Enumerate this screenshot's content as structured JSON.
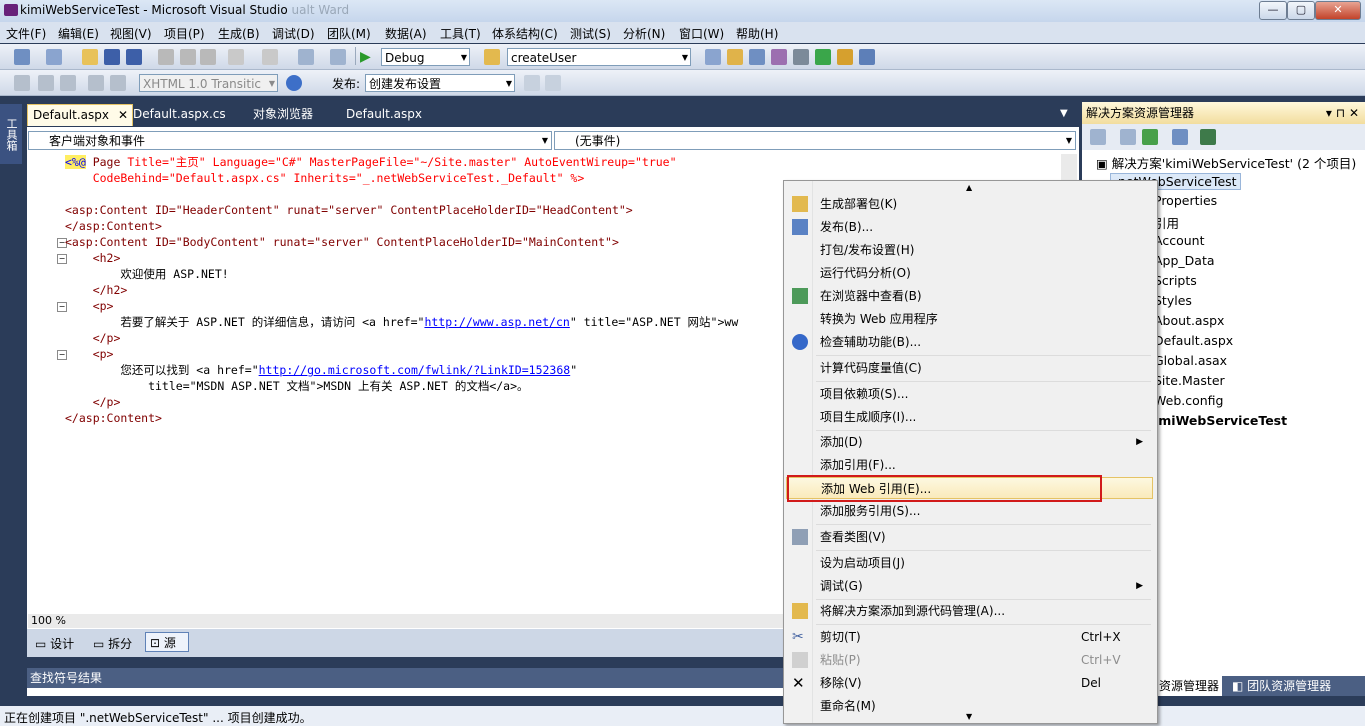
{
  "window": {
    "title": "kimiWebServiceTest - Microsoft Visual Studio",
    "title_ghost": "ualt Ward",
    "controls": [
      "—",
      "▢",
      "✕"
    ]
  },
  "menubar": [
    "文件(F)",
    "编辑(E)",
    "视图(V)",
    "项目(P)",
    "生成(B)",
    "调试(D)",
    "团队(M)",
    "数据(A)",
    "工具(T)",
    "体系结构(C)",
    "测试(S)",
    "分析(N)",
    "窗口(W)",
    "帮助(H)"
  ],
  "toolbar1": {
    "config": "Debug",
    "find": "createUser"
  },
  "toolbar2": {
    "schema": "XHTML 1.0 Transitic",
    "publish_label": "发布:",
    "publish_value": "创建发布设置"
  },
  "toolbox_label": "工具箱",
  "tabs": [
    "Default.aspx",
    "Default.aspx.cs",
    "对象浏览器",
    "Default.aspx"
  ],
  "editor": {
    "nav_left": "客户端对象和事件",
    "nav_right": "(无事件)",
    "zoom": "100 %",
    "views": [
      "设计",
      "拆分",
      "源"
    ],
    "lines": {
      "l1_a": "<%@",
      "l1_b": " Page ",
      "l1_c": "Title=\"主页\" Language=\"C#\" MasterPageFile=\"~/Site.master\" AutoEventWireup=\"true\"",
      "l2": "    CodeBehind=\"Default.aspx.cs\" Inherits=\"_.netWebServiceTest._Default\" %>",
      "l4": "<asp:Content ID=\"HeaderContent\" runat=\"server\" ContentPlaceHolderID=\"HeadContent\">",
      "l5": "</asp:Content>",
      "l6": "<asp:Content ID=\"BodyContent\" runat=\"server\" ContentPlaceHolderID=\"MainContent\">",
      "l7": "    <h2>",
      "l8": "        欢迎使用 ASP.NET!",
      "l9": "    </h2>",
      "l10": "    <p>",
      "l11_a": "        若要了解关于 ASP.NET 的详细信息，请访问 <a href=\"",
      "l11_link": "http://www.asp.net/cn",
      "l11_b": "\" title=\"ASP.NET 网站\">ww",
      "l12": "    </p>",
      "l13": "    <p>",
      "l14_a": "        您还可以找到 <a href=\"",
      "l14_link": "http://go.microsoft.com/fwlink/?LinkID=152368",
      "l14_b": "\"",
      "l15": "            title=\"MSDN ASP.NET 文档\">MSDN 上有关 ASP.NET 的文档</a>。",
      "l16": "    </p>",
      "l17": "</asp:Content>"
    }
  },
  "context_menu": {
    "items": [
      {
        "label": "生成部署包(K)",
        "icon": "package-icon"
      },
      {
        "label": "发布(B)...",
        "icon": "publish-icon"
      },
      {
        "label": "打包/发布设置(H)",
        "icon": ""
      },
      {
        "label": "运行代码分析(O)",
        "icon": ""
      },
      {
        "label": "在浏览器中查看(B)",
        "icon": "browser-icon"
      },
      {
        "label": "转换为 Web 应用程序",
        "icon": ""
      },
      {
        "label": "检查辅助功能(B)...",
        "icon": "accessibility-icon"
      },
      {
        "label": "计算代码度量值(C)",
        "icon": ""
      },
      {
        "label": "项目依赖项(S)...",
        "icon": ""
      },
      {
        "label": "项目生成顺序(I)...",
        "icon": ""
      },
      {
        "label": "添加(D)",
        "icon": "",
        "submenu": true
      },
      {
        "label": "添加引用(F)...",
        "icon": ""
      },
      {
        "label": "添加 Web 引用(E)...",
        "icon": "",
        "highlight": true
      },
      {
        "label": "添加服务引用(S)...",
        "icon": ""
      },
      {
        "label": "查看类图(V)",
        "icon": "class-diagram-icon"
      },
      {
        "label": "设为启动项目(J)",
        "icon": ""
      },
      {
        "label": "调试(G)",
        "icon": "",
        "submenu": true
      },
      {
        "label": "将解决方案添加到源代码管理(A)...",
        "icon": "source-control-icon"
      },
      {
        "label": "剪切(T)",
        "icon": "cut-icon",
        "shortcut": "Ctrl+X"
      },
      {
        "label": "粘贴(P)",
        "icon": "paste-icon",
        "shortcut": "Ctrl+V",
        "disabled": true
      },
      {
        "label": "移除(V)",
        "icon": "remove-icon",
        "shortcut": "Del"
      },
      {
        "label": "重命名(M)",
        "icon": ""
      }
    ]
  },
  "solution_explorer": {
    "title": "解决方案资源管理器",
    "solution": "解决方案'kimiWebServiceTest' (2 个项目)",
    "project": ".netWebServiceTest",
    "children": [
      "Properties",
      "引用",
      "Account",
      "App_Data",
      "Scripts",
      "Styles",
      "About.aspx",
      "Default.aspx",
      "Global.asax",
      "Site.Master",
      "Web.config"
    ],
    "project2": "imiWebServiceTest",
    "bottom_tabs": [
      "资源管理器",
      "团队资源管理器"
    ]
  },
  "find_results": "查找符号结果",
  "status": "正在创建项目 \".netWebServiceTest\" ... 项目创建成功。"
}
